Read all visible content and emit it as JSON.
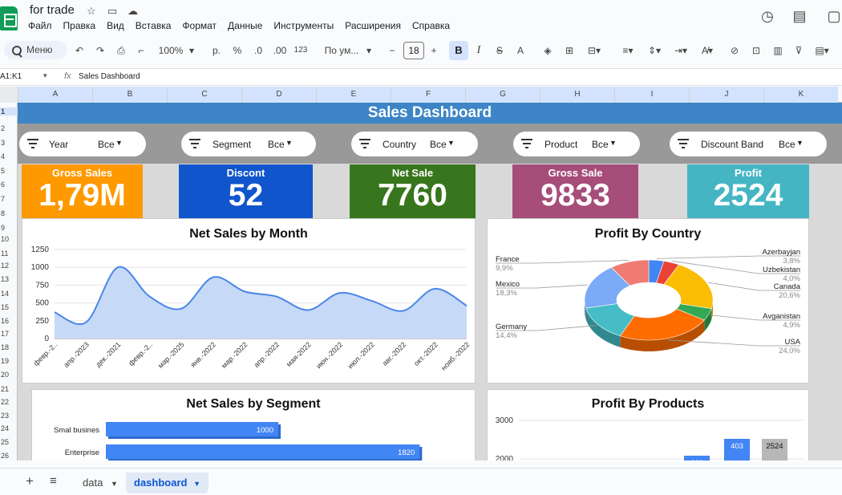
{
  "doc": {
    "title": "for trade"
  },
  "menu": [
    "Файл",
    "Правка",
    "Вид",
    "Вставка",
    "Формат",
    "Данные",
    "Инструменты",
    "Расширения",
    "Справка"
  ],
  "toolbar": {
    "search": "Меню",
    "zoom": "100%",
    "currency": "р.",
    "percent": "%",
    "dec_less": ".0",
    "dec_more": ".00",
    "number_fmt": "123",
    "font": "По ум...",
    "font_size": "18",
    "bold": "B",
    "italic": "I",
    "strike": "S",
    "text_color": "A"
  },
  "formula": {
    "cell_ref": "A1:K1",
    "fx": "fx",
    "content": "Sales Dashboard"
  },
  "columns": [
    "A",
    "B",
    "C",
    "D",
    "E",
    "F",
    "G",
    "H",
    "I",
    "J",
    "K"
  ],
  "rows": [
    "1",
    "2",
    "3",
    "4",
    "5",
    "6",
    "7",
    "8",
    "9",
    "10",
    "11",
    "12",
    "13",
    "14",
    "15",
    "16",
    "17",
    "18",
    "19",
    "20",
    "21",
    "22",
    "23",
    "24",
    "25",
    "26"
  ],
  "dashboard": {
    "title": "Sales Dashboard",
    "filters": [
      {
        "label": "Year",
        "value": "Все"
      },
      {
        "label": "Segment",
        "value": "Все"
      },
      {
        "label": "Country",
        "value": "Все"
      },
      {
        "label": "Product",
        "value": "Все"
      },
      {
        "label": "Discount Band",
        "value": "Все"
      }
    ],
    "kpis": [
      {
        "title": "Gross Sales",
        "value": "1,79M",
        "color": "#ff9900"
      },
      {
        "title": "Discont",
        "value": "52",
        "color": "#1155cc"
      },
      {
        "title": "Net Sale",
        "value": "7760",
        "color": "#38761d"
      },
      {
        "title": "Gross Sale",
        "value": "9833",
        "color": "#a64d79"
      },
      {
        "title": "Profit",
        "value": "2524",
        "color": "#45b5c4"
      }
    ]
  },
  "charts": {
    "net_month_title": "Net Sales by Month",
    "profit_country_title": "Profit By Country",
    "segment_title": "Net Sales by Segment",
    "products_title": "Profit By Products"
  },
  "chart_data": [
    {
      "type": "area",
      "title": "Net Sales by Month",
      "x": [
        "февр.-2..",
        "апр.-2023",
        "дек.-2021",
        "февр.-2..",
        "мар.-2025",
        "янв.-2022",
        "мар.-2022",
        "апр.-2022",
        "мая-2022",
        "июн.-2022",
        "июл.-2022",
        "авг.-2022",
        "окт.-2022",
        "нояб.-2022"
      ],
      "yticks": [
        0,
        250,
        500,
        750,
        1000,
        1250
      ],
      "ylim": [
        0,
        1250
      ],
      "values": [
        370,
        230,
        1000,
        590,
        420,
        860,
        660,
        590,
        400,
        640,
        530,
        390,
        700,
        460
      ],
      "color": "#4a86e8"
    },
    {
      "type": "pie",
      "title": "Profit By Country",
      "slices": [
        {
          "name": "Azerbayjan",
          "value": 3.8,
          "label": "3,8%",
          "color": "#4285f4"
        },
        {
          "name": "Uzbekistan",
          "value": 4.0,
          "label": "4,0%",
          "color": "#ea4335"
        },
        {
          "name": "Canada",
          "value": 20.6,
          "label": "20,6%",
          "color": "#fbbc04"
        },
        {
          "name": "Avganistan",
          "value": 4.9,
          "label": "4,9%",
          "color": "#34a853"
        },
        {
          "name": "USA",
          "value": 24.0,
          "label": "24,0%",
          "color": "#ff6d01"
        },
        {
          "name": "Germany",
          "value": 14.4,
          "label": "14,4%",
          "color": "#46bdc6"
        },
        {
          "name": "Mexico",
          "value": 18.3,
          "label": "18,3%",
          "color": "#7baaf7"
        },
        {
          "name": "France",
          "value": 9.9,
          "label": "9,9%",
          "color": "#f07b72"
        }
      ]
    },
    {
      "type": "bar",
      "title": "Net Sales by Segment",
      "categories": [
        "Smal busines",
        "Enterprise"
      ],
      "values": [
        1000,
        1820
      ],
      "color": "#4285f4"
    },
    {
      "type": "bar",
      "title": "Profit By Products",
      "yticks": [
        2000,
        3000
      ],
      "visible_labels": [
        "262",
        "403",
        "2524"
      ],
      "values": [
        262,
        403,
        2524
      ],
      "colors": [
        "#4285f4",
        "#4285f4",
        "#b7b7b7"
      ]
    }
  ],
  "sheet_tabs": [
    {
      "label": "data"
    },
    {
      "label": "dashboard",
      "active": true
    }
  ]
}
